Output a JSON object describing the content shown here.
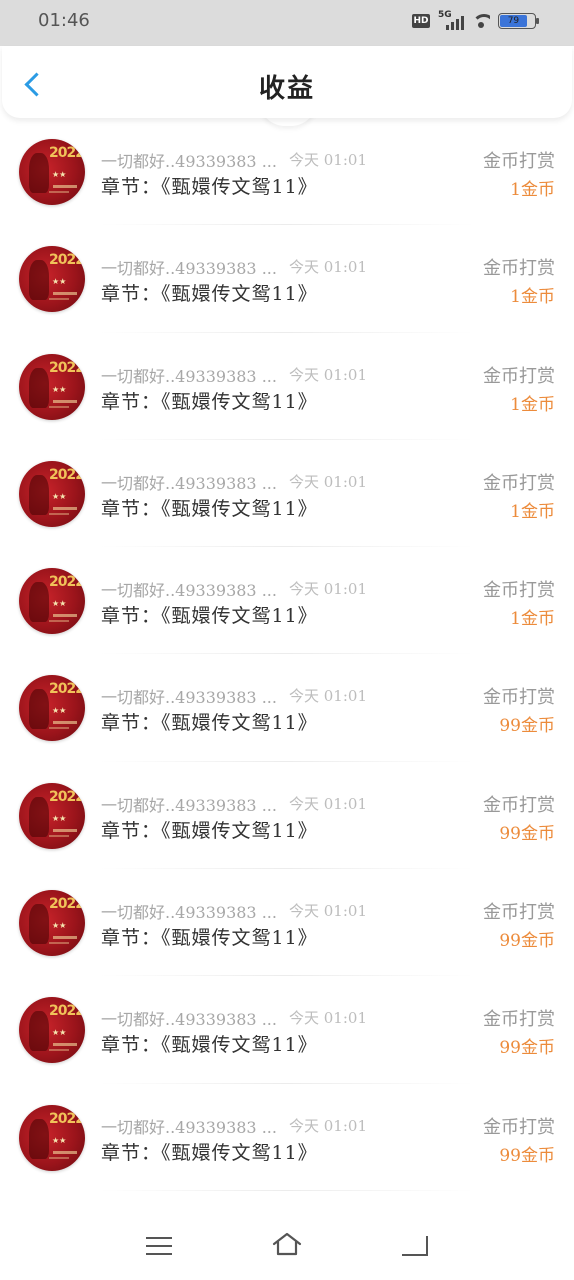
{
  "status_bar": {
    "time": "01:46",
    "network": "5G",
    "hd": "HD",
    "battery": "79",
    "battery_level_percent": 79
  },
  "header": {
    "title": "收益",
    "back_icon": "chevron-left-icon",
    "accent_color": "#2b9be4"
  },
  "colors": {
    "amount": "#ec8b3b",
    "secondary_text": "#a7a7a7"
  },
  "list": {
    "items": [
      {
        "name": "一切都好..49339383 ...",
        "time": "今天 01:01",
        "type": "金币打赏",
        "chapter": "章节：《甄嬛传文鸳11》",
        "amount": "1金币"
      },
      {
        "name": "一切都好..49339383 ...",
        "time": "今天 01:01",
        "type": "金币打赏",
        "chapter": "章节：《甄嬛传文鸳11》",
        "amount": "1金币"
      },
      {
        "name": "一切都好..49339383 ...",
        "time": "今天 01:01",
        "type": "金币打赏",
        "chapter": "章节：《甄嬛传文鸳11》",
        "amount": "1金币"
      },
      {
        "name": "一切都好..49339383 ...",
        "time": "今天 01:01",
        "type": "金币打赏",
        "chapter": "章节：《甄嬛传文鸳11》",
        "amount": "1金币"
      },
      {
        "name": "一切都好..49339383 ...",
        "time": "今天 01:01",
        "type": "金币打赏",
        "chapter": "章节：《甄嬛传文鸳11》",
        "amount": "1金币"
      },
      {
        "name": "一切都好..49339383 ...",
        "time": "今天 01:01",
        "type": "金币打赏",
        "chapter": "章节：《甄嬛传文鸳11》",
        "amount": "99金币"
      },
      {
        "name": "一切都好..49339383 ...",
        "time": "今天 01:01",
        "type": "金币打赏",
        "chapter": "章节：《甄嬛传文鸳11》",
        "amount": "99金币"
      },
      {
        "name": "一切都好..49339383 ...",
        "time": "今天 01:01",
        "type": "金币打赏",
        "chapter": "章节：《甄嬛传文鸳11》",
        "amount": "99金币"
      },
      {
        "name": "一切都好..49339383 ...",
        "time": "今天 01:01",
        "type": "金币打赏",
        "chapter": "章节：《甄嬛传文鸳11》",
        "amount": "99金币"
      },
      {
        "name": "一切都好..49339383 ...",
        "time": "今天 01:01",
        "type": "金币打赏",
        "chapter": "章节：《甄嬛传文鸳11》",
        "amount": "99金币"
      }
    ]
  },
  "nav_bar": {
    "menu_icon": "menu-icon",
    "home_icon": "home-icon",
    "back_icon": "back-icon"
  }
}
